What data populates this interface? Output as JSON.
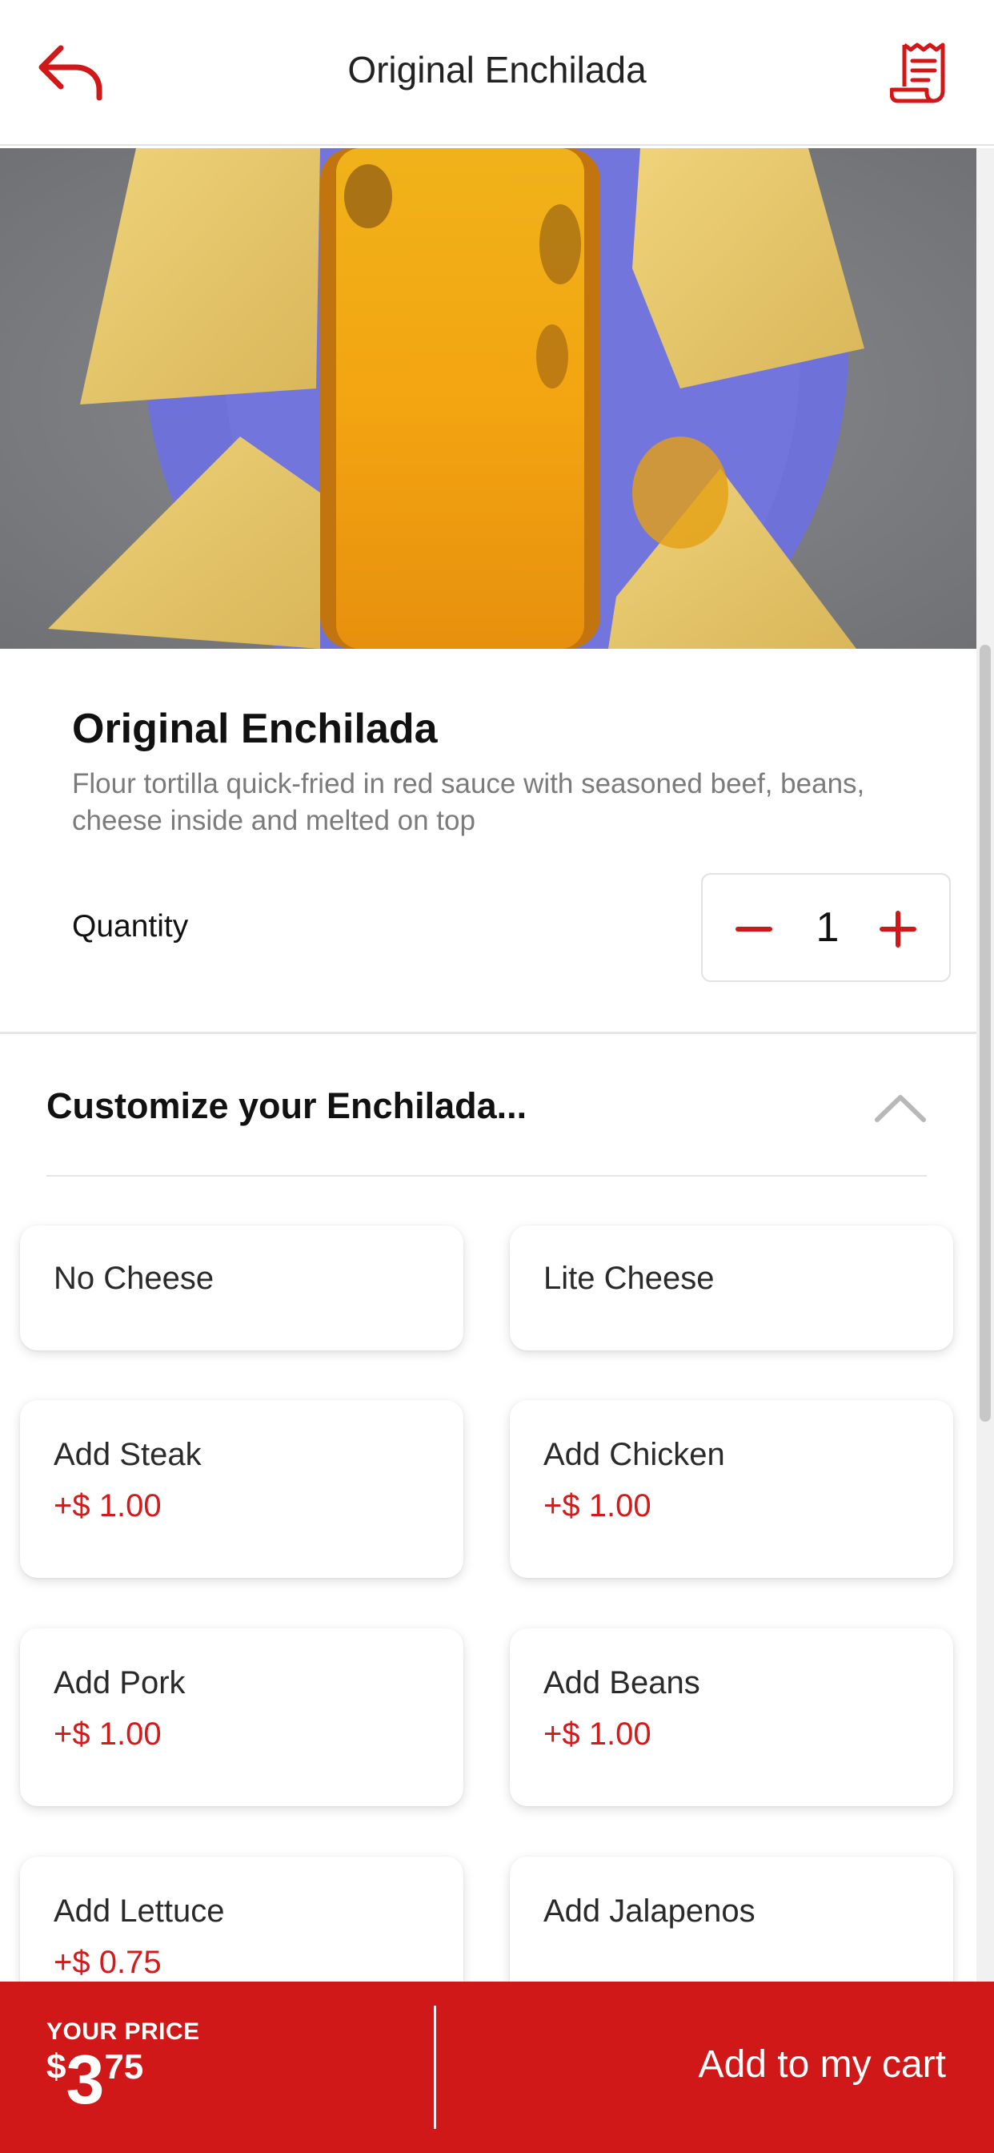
{
  "header": {
    "title": "Original Enchilada",
    "back_icon": "back-arrow-icon",
    "receipt_icon": "receipt-icon"
  },
  "item": {
    "title": "Original Enchilada",
    "description": "Flour tortilla quick-fried in red sauce with seasoned beef, beans, cheese inside and melted on top"
  },
  "quantity": {
    "label": "Quantity",
    "value": "1"
  },
  "customize": {
    "title": "Customize your Enchilada...",
    "options": [
      {
        "name": "No Cheese",
        "price": ""
      },
      {
        "name": "Lite Cheese",
        "price": ""
      },
      {
        "name": "Add Steak",
        "price": "+$ 1.00"
      },
      {
        "name": "Add Chicken",
        "price": "+$ 1.00"
      },
      {
        "name": "Add Pork",
        "price": "+$ 1.00"
      },
      {
        "name": "Add Beans",
        "price": "+$ 1.00"
      },
      {
        "name": "Add Lettuce",
        "price": "+$ 0.75"
      },
      {
        "name": "Add Jalapenos",
        "price": ""
      }
    ]
  },
  "footer": {
    "your_price_label": "YOUR PRICE",
    "currency": "$",
    "price_dollars": "3",
    "price_cents": "75",
    "add_to_cart": "Add to my cart"
  },
  "colors": {
    "accent": "#d01818",
    "price_red": "#d31b1b"
  }
}
